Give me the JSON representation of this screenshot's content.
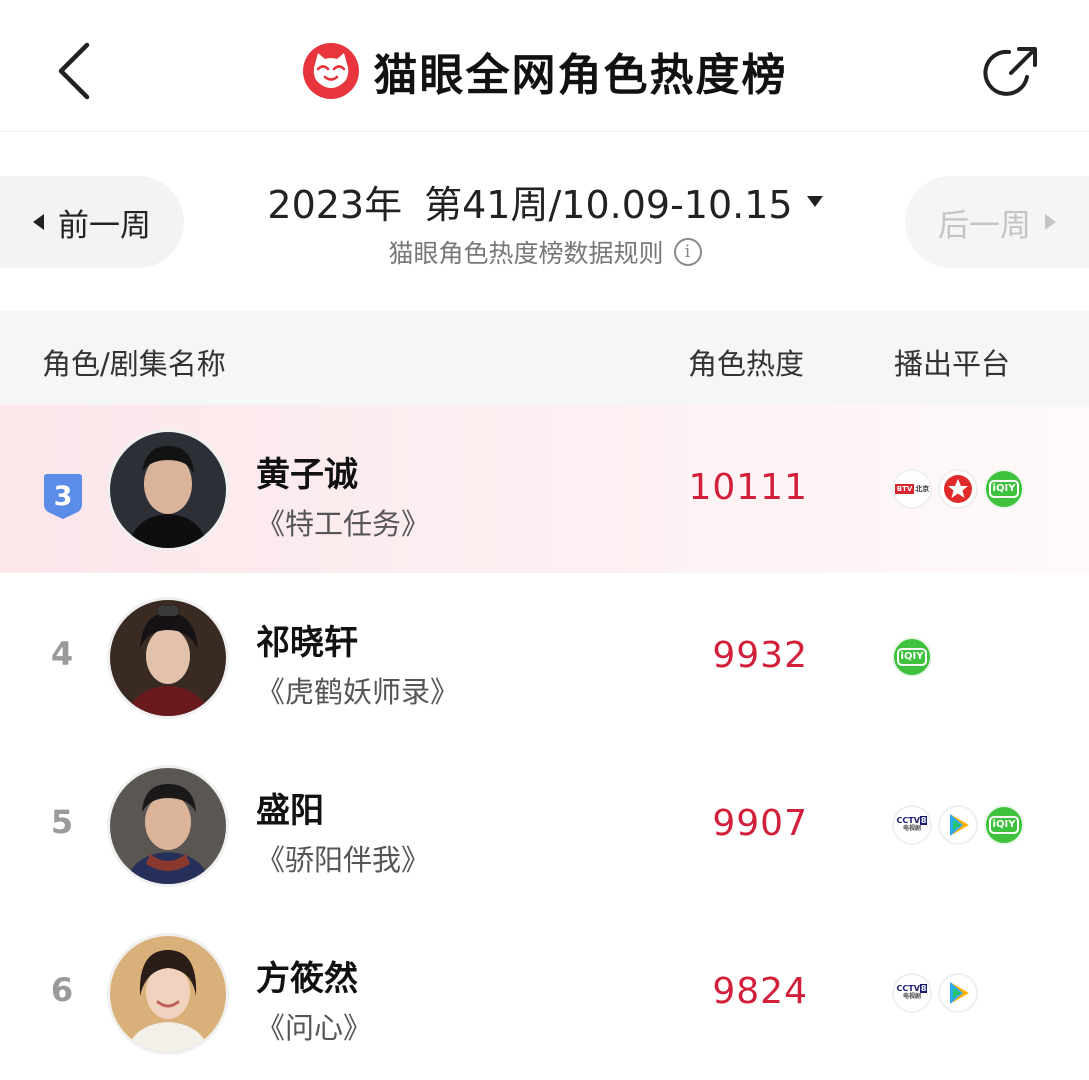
{
  "header": {
    "back_icon": "chevron-left-icon",
    "logo_icon": "maoyan-cat-logo-icon",
    "title": "猫眼全网角色热度榜",
    "share_icon": "share-icon",
    "brand_color": "#e8343c"
  },
  "week_selector": {
    "prev_label": "前一周",
    "next_label": "后一周",
    "year": "2023年",
    "week_range": "第41周/10.09-10.15",
    "rules_text": "猫眼角色热度榜数据规则",
    "info_icon": "info-icon",
    "info_glyph": "i"
  },
  "table": {
    "headers": {
      "name": "角色/剧集名称",
      "heat": "角色热度",
      "platform": "播出平台"
    },
    "rows": [
      {
        "rank": "3",
        "rank_badge": true,
        "name": "黄子诚",
        "drama": "《特工任务》",
        "heat": "10111",
        "platforms": [
          "btv-beijing",
          "dragon-tv",
          "iqiyi"
        ]
      },
      {
        "rank": "4",
        "rank_badge": false,
        "name": "祁晓轩",
        "drama": "《虎鹤妖师录》",
        "heat": "9932",
        "platforms": [
          "iqiyi"
        ]
      },
      {
        "rank": "5",
        "rank_badge": false,
        "name": "盛阳",
        "drama": "《骄阳伴我》",
        "heat": "9907",
        "platforms": [
          "cctv-8",
          "tencent-video",
          "iqiyi"
        ]
      },
      {
        "rank": "6",
        "rank_badge": false,
        "name": "方筱然",
        "drama": "《问心》",
        "heat": "9824",
        "platforms": [
          "cctv-8",
          "tencent-video"
        ]
      }
    ]
  },
  "platform_labels": {
    "iqiyi": "iQIY",
    "btv": "BTV",
    "btv_city": "北京",
    "cctv": "CCTV",
    "cctv_channel": "8",
    "cctv_sub": "电视剧"
  },
  "colors": {
    "heat_red": "#d3203a",
    "rank_badge_blue": "#5b8de8",
    "highlight_row": "#fbe6ea"
  }
}
